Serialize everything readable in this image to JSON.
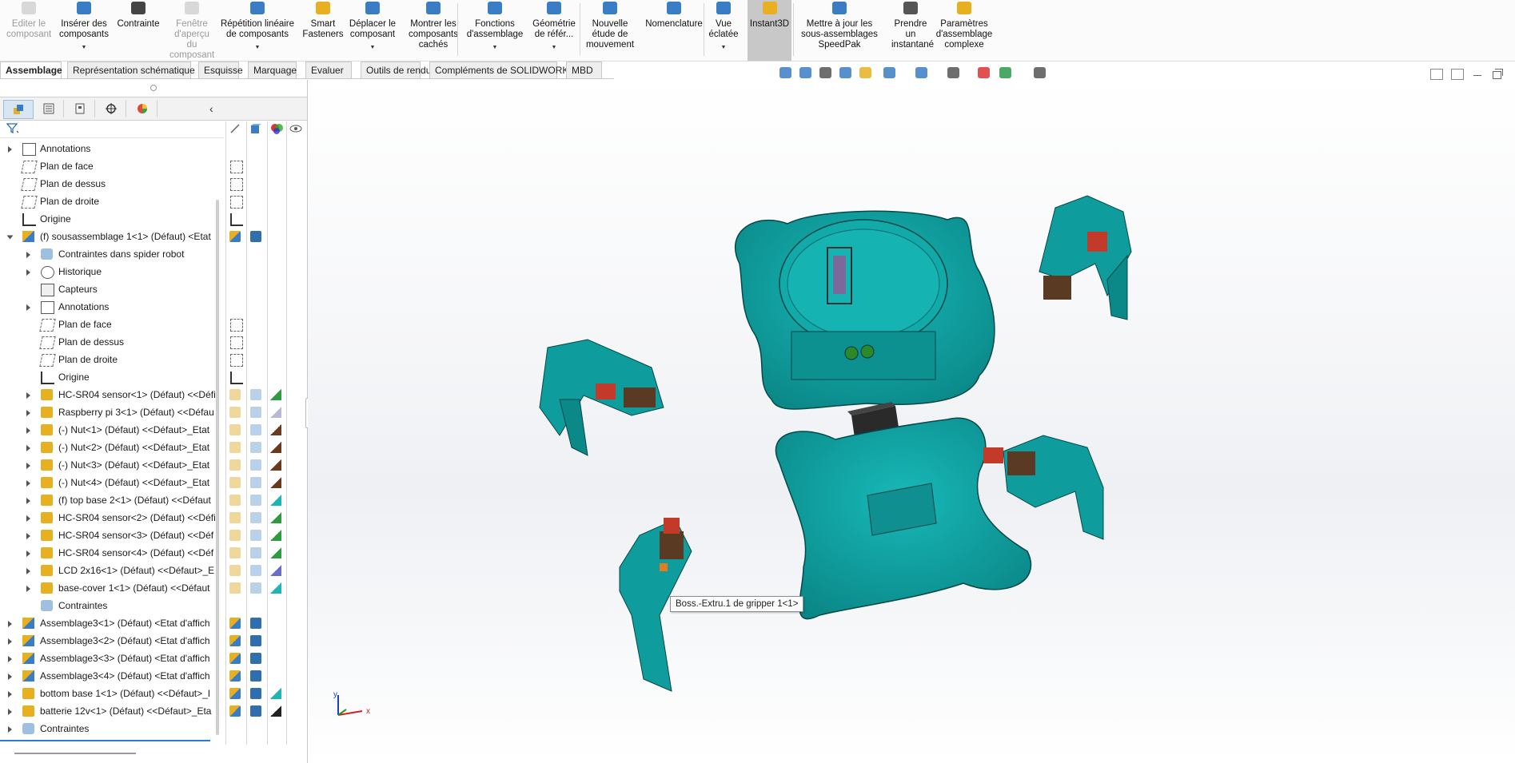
{
  "ribbon": {
    "buttons": [
      {
        "label": "Editer le\ncomposant",
        "icon": "edit-component-icon",
        "disabled": true
      },
      {
        "label": "Insérer des\ncomposants",
        "icon": "insert-components-icon",
        "dropdown": true
      },
      {
        "label": "Contrainte",
        "icon": "mate-paperclip-icon"
      },
      {
        "label": "Fenêtre\nd'aperçu\ndu\ncomposant",
        "icon": "preview-window-icon",
        "disabled": true
      },
      {
        "label": "Répétition linéaire\nde composants",
        "icon": "linear-pattern-icon",
        "dropdown": true
      },
      {
        "label": "Smart\nFasteners",
        "icon": "smart-fasteners-icon"
      },
      {
        "label": "Déplacer le\ncomposant",
        "icon": "move-component-icon",
        "dropdown": true
      },
      {
        "label": "Montrer les\ncomposants\ncachés",
        "icon": "show-hidden-icon"
      },
      {
        "label": "Fonctions\nd'assemblage",
        "icon": "assembly-features-icon",
        "dropdown": true
      },
      {
        "label": "Géométrie\nde référ...",
        "icon": "reference-geometry-icon",
        "dropdown": true
      },
      {
        "label": "Nouvelle\nétude de\nmouvement",
        "icon": "motion-study-icon"
      },
      {
        "label": "Nomenclature",
        "icon": "bom-icon"
      },
      {
        "label": "Vue\néclatée",
        "icon": "exploded-view-icon",
        "dropdown": true
      },
      {
        "label": "Instant3D",
        "icon": "instant3d-icon",
        "active": true
      },
      {
        "label": "Mettre à jour les\nsous-assemblages\nSpeedPak",
        "icon": "speedpak-icon"
      },
      {
        "label": "Prendre\nun\ninstantané",
        "icon": "snapshot-camera-icon"
      },
      {
        "label": "Paramètres\nd'assemblage\ncomplexe",
        "icon": "large-assembly-icon"
      }
    ]
  },
  "tabs": [
    "Assemblage",
    "Représentation schématique",
    "Esquisse",
    "Marquage",
    "Evaluer",
    "Outils de rendu",
    "Compléments de SOLIDWORKS",
    "MBD"
  ],
  "tree": [
    {
      "label": "Annotations",
      "icon": "annotations-icon",
      "level": 0,
      "expand": true,
      "cols": [
        "plane",
        "",
        "",
        ""
      ]
    },
    {
      "label": "Plan de face",
      "icon": "plane-icon",
      "level": 0,
      "expand": false
    },
    {
      "label": "Plan de dessus",
      "icon": "plane-icon",
      "level": 0,
      "expand": false
    },
    {
      "label": "Plan de droite",
      "icon": "plane-icon",
      "level": 0,
      "expand": false
    },
    {
      "label": "Origine",
      "icon": "origin-icon",
      "level": 0,
      "expand": false
    },
    {
      "label": "(f) sousassemblage 1<1> (Défaut) <Etat",
      "icon": "subassembly-icon",
      "level": 0,
      "expand": true,
      "open": true
    },
    {
      "label": "Contraintes dans spider robot",
      "icon": "mates-folder-icon",
      "level": 1,
      "expand": true
    },
    {
      "label": "Historique",
      "icon": "history-icon",
      "level": 1,
      "expand": true
    },
    {
      "label": "Capteurs",
      "icon": "sensors-icon",
      "level": 1,
      "expand": false
    },
    {
      "label": "Annotations",
      "icon": "annotations-icon",
      "level": 1,
      "expand": true
    },
    {
      "label": "Plan de face",
      "icon": "plane-icon",
      "level": 1,
      "expand": false
    },
    {
      "label": "Plan de dessus",
      "icon": "plane-icon",
      "level": 1,
      "expand": false
    },
    {
      "label": "Plan de droite",
      "icon": "plane-icon",
      "level": 1,
      "expand": false
    },
    {
      "label": "Origine",
      "icon": "origin-icon",
      "level": 1,
      "expand": false
    },
    {
      "label": "HC-SR04 sensor<1> (Défaut) <<Défi",
      "icon": "part-icon",
      "level": 1,
      "expand": true,
      "appearance": "#2e9c3e"
    },
    {
      "label": "Raspberry pi 3<1> (Défaut) <<Défau",
      "icon": "part-icon",
      "level": 1,
      "expand": true,
      "appearance": "#b9b9d6"
    },
    {
      "label": "(-) Nut<1> (Défaut) <<Défaut>_Etat",
      "icon": "part-icon",
      "level": 1,
      "expand": true,
      "appearance": "#6a3a1e"
    },
    {
      "label": "(-) Nut<2> (Défaut) <<Défaut>_Etat",
      "icon": "part-icon",
      "level": 1,
      "expand": true,
      "appearance": "#6a3a1e"
    },
    {
      "label": "(-) Nut<3> (Défaut) <<Défaut>_Etat",
      "icon": "part-icon",
      "level": 1,
      "expand": true,
      "appearance": "#6a3a1e"
    },
    {
      "label": "(-) Nut<4> (Défaut) <<Défaut>_Etat",
      "icon": "part-icon",
      "level": 1,
      "expand": true,
      "appearance": "#6a3a1e"
    },
    {
      "label": "(f) top base 2<1> (Défaut) <<Défaut",
      "icon": "part-icon",
      "level": 1,
      "expand": true,
      "appearance": "#1fb5b5"
    },
    {
      "label": "HC-SR04 sensor<2> (Défaut) <<Défi",
      "icon": "part-icon",
      "level": 1,
      "expand": true,
      "appearance": "#2e9c3e"
    },
    {
      "label": "HC-SR04 sensor<3> (Défaut) <<Déf",
      "icon": "part-icon",
      "level": 1,
      "expand": true,
      "appearance": "#2e9c3e"
    },
    {
      "label": "HC-SR04 sensor<4> (Défaut) <<Déf",
      "icon": "part-icon",
      "level": 1,
      "expand": true,
      "appearance": "#2e9c3e"
    },
    {
      "label": "LCD 2x16<1> (Défaut) <<Défaut>_E",
      "icon": "part-icon",
      "level": 1,
      "expand": true,
      "appearance": "#6b6bc8"
    },
    {
      "label": "base-cover 1<1> (Défaut) <<Défaut",
      "icon": "part-icon",
      "level": 1,
      "expand": true,
      "appearance": "#1fb5b5"
    },
    {
      "label": "Contraintes",
      "icon": "mates-folder-icon",
      "level": 1,
      "expand": false
    },
    {
      "label": "Assemblage3<1> (Défaut) <Etat d'affich",
      "icon": "subassembly-icon",
      "level": 0,
      "expand": true
    },
    {
      "label": "Assemblage3<2> (Défaut) <Etat d'affich",
      "icon": "subassembly-icon",
      "level": 0,
      "expand": true
    },
    {
      "label": "Assemblage3<3> (Défaut) <Etat d'affich",
      "icon": "subassembly-icon",
      "level": 0,
      "expand": true
    },
    {
      "label": "Assemblage3<4> (Défaut) <Etat d'affich",
      "icon": "subassembly-icon",
      "level": 0,
      "expand": true
    },
    {
      "label": "bottom base 1<1> (Défaut) <<Défaut>_I",
      "icon": "part-icon",
      "level": 0,
      "expand": true,
      "appearance": "#1fb5b5"
    },
    {
      "label": "batterie 12v<1> (Défaut) <<Défaut>_Eta",
      "icon": "part-icon",
      "level": 0,
      "expand": true,
      "appearance": "#222222"
    },
    {
      "label": "Contraintes",
      "icon": "mates-folder-icon",
      "level": 0,
      "expand": true
    }
  ],
  "viewport": {
    "tooltip": "Boss.-Extru.1 de gripper 1<1>",
    "triad_x": "x",
    "triad_y": "y",
    "model_color": "#0f9e9e"
  }
}
